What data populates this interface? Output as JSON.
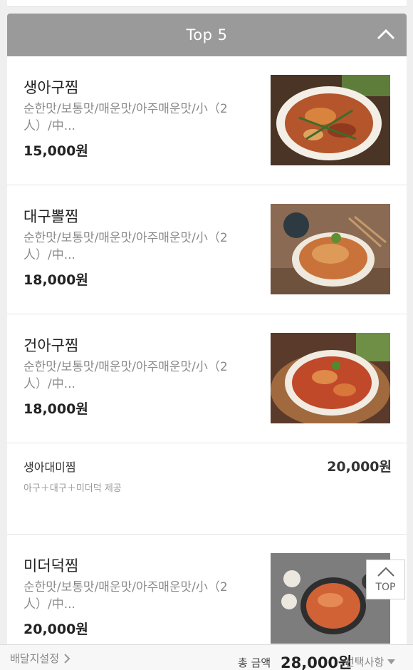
{
  "section": {
    "title": "Top 5"
  },
  "items": [
    {
      "name": "생아구찜",
      "desc": "순한맛/보통맛/매운맛/아주매운맛/小（2人）/中...",
      "price": "15,000원"
    },
    {
      "name": "대구뽈찜",
      "desc": "순한맛/보통맛/매운맛/아주매운맛/小（2人）/中...",
      "price": "18,000원"
    },
    {
      "name": "건아구찜",
      "desc": "순한맛/보통맛/매운맛/아주매운맛/小（2人）/中...",
      "price": "18,000원"
    },
    {
      "name": "생아대미찜",
      "desc": "아구＋대구＋미더덕 제공",
      "price": "20,000원"
    },
    {
      "name": "미더덕찜",
      "desc": "순한맛/보통맛/매운맛/아주매운맛/小（2人）/中...",
      "price": "20,000원"
    }
  ],
  "top_button": {
    "label": "TOP"
  },
  "footer": {
    "delivery_label": "배달지설정",
    "total_label": "총 금액",
    "total_value": "28,000원",
    "options_label": "선택사항"
  }
}
